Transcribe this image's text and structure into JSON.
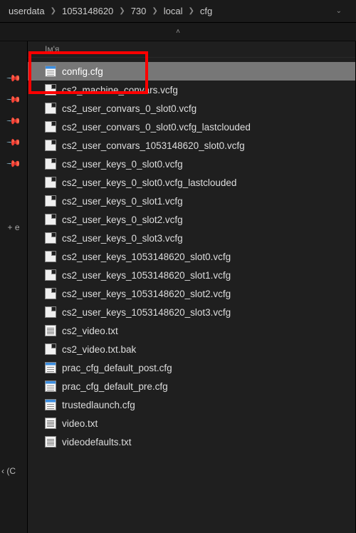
{
  "breadcrumb": {
    "items": [
      "userdata",
      "1053148620",
      "730",
      "local",
      "cfg"
    ]
  },
  "columnHeader": "Ім'я",
  "gutterLabel": "+ е",
  "bottomLabel": "‹ (C",
  "files": [
    {
      "name": "config.cfg",
      "icon": "icon-cfg",
      "selected": true
    },
    {
      "name": "cs2_machine_convars.vcfg",
      "icon": "icon-generic",
      "selected": false
    },
    {
      "name": "cs2_user_convars_0_slot0.vcfg",
      "icon": "icon-generic",
      "selected": false
    },
    {
      "name": "cs2_user_convars_0_slot0.vcfg_lastclouded",
      "icon": "icon-generic",
      "selected": false
    },
    {
      "name": "cs2_user_convars_1053148620_slot0.vcfg",
      "icon": "icon-generic",
      "selected": false
    },
    {
      "name": "cs2_user_keys_0_slot0.vcfg",
      "icon": "icon-generic",
      "selected": false
    },
    {
      "name": "cs2_user_keys_0_slot0.vcfg_lastclouded",
      "icon": "icon-generic",
      "selected": false
    },
    {
      "name": "cs2_user_keys_0_slot1.vcfg",
      "icon": "icon-generic",
      "selected": false
    },
    {
      "name": "cs2_user_keys_0_slot2.vcfg",
      "icon": "icon-generic",
      "selected": false
    },
    {
      "name": "cs2_user_keys_0_slot3.vcfg",
      "icon": "icon-generic",
      "selected": false
    },
    {
      "name": "cs2_user_keys_1053148620_slot0.vcfg",
      "icon": "icon-generic",
      "selected": false
    },
    {
      "name": "cs2_user_keys_1053148620_slot1.vcfg",
      "icon": "icon-generic",
      "selected": false
    },
    {
      "name": "cs2_user_keys_1053148620_slot2.vcfg",
      "icon": "icon-generic",
      "selected": false
    },
    {
      "name": "cs2_user_keys_1053148620_slot3.vcfg",
      "icon": "icon-generic",
      "selected": false
    },
    {
      "name": "cs2_video.txt",
      "icon": "icon-txt",
      "selected": false
    },
    {
      "name": "cs2_video.txt.bak",
      "icon": "icon-generic",
      "selected": false
    },
    {
      "name": "prac_cfg_default_post.cfg",
      "icon": "icon-cfg",
      "selected": false
    },
    {
      "name": "prac_cfg_default_pre.cfg",
      "icon": "icon-cfg",
      "selected": false
    },
    {
      "name": "trustedlaunch.cfg",
      "icon": "icon-cfg",
      "selected": false
    },
    {
      "name": "video.txt",
      "icon": "icon-txt",
      "selected": false
    },
    {
      "name": "videodefaults.txt",
      "icon": "icon-txt",
      "selected": false
    }
  ]
}
